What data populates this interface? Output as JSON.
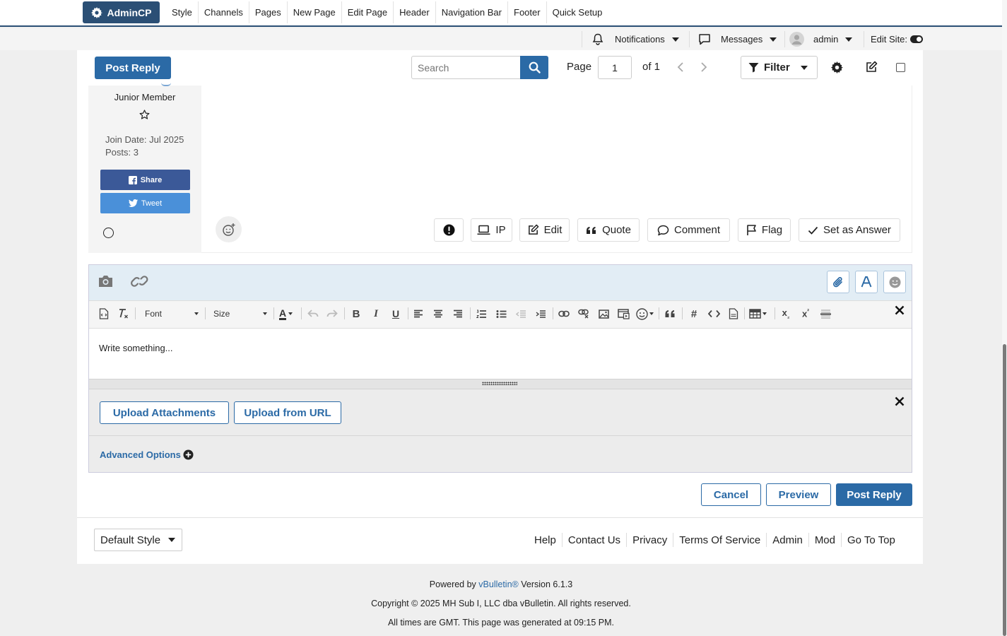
{
  "admin_bar": {
    "admincp_label": "AdminCP",
    "menu": [
      "Style",
      "Channels",
      "Pages",
      "New Page",
      "Edit Page",
      "Header",
      "Navigation Bar",
      "Footer",
      "Quick Setup"
    ]
  },
  "user_bar": {
    "notifications": "Notifications",
    "messages": "Messages",
    "username": "admin",
    "edit_site": "Edit Site:"
  },
  "toolbar": {
    "post_reply": "Post Reply",
    "search_placeholder": "Search",
    "page_label": "Page",
    "page_value": "1",
    "page_of": "of 1",
    "filter": "Filter"
  },
  "post": {
    "user_title": "Junior Member",
    "join_date": "Join Date: Jul 2025",
    "posts": "Posts: 3",
    "share": "Share",
    "tweet": "Tweet",
    "actions": {
      "ip": "IP",
      "edit": "Edit",
      "quote": "Quote",
      "comment": "Comment",
      "flag": "Flag",
      "set_answer": "Set as Answer"
    }
  },
  "editor": {
    "font_label": "Font",
    "size_label": "Size",
    "text_color_icon": "A",
    "placeholder": "Write something...",
    "upload_attachments": "Upload Attachments",
    "upload_url": "Upload from URL",
    "advanced_options": "Advanced Options"
  },
  "form_buttons": {
    "cancel": "Cancel",
    "preview": "Preview",
    "post_reply": "Post Reply"
  },
  "footer": {
    "style_select": "Default Style",
    "links": [
      "Help",
      "Contact Us",
      "Privacy",
      "Terms Of Service",
      "Admin",
      "Mod",
      "Go To Top"
    ]
  },
  "copyright": {
    "powered_prefix": "Powered by ",
    "powered_brand": "vBulletin®",
    "powered_suffix": " Version 6.1.3",
    "line2": "Copyright © 2025 MH Sub I, LLC dba vBulletin. All rights reserved.",
    "line3": "All times are GMT. This page was generated at 09:15 PM."
  },
  "colors": {
    "brand": "#2b4f75",
    "primary": "#2b6aa6",
    "facebook": "#3b5998",
    "twitter": "#4a90d9"
  }
}
